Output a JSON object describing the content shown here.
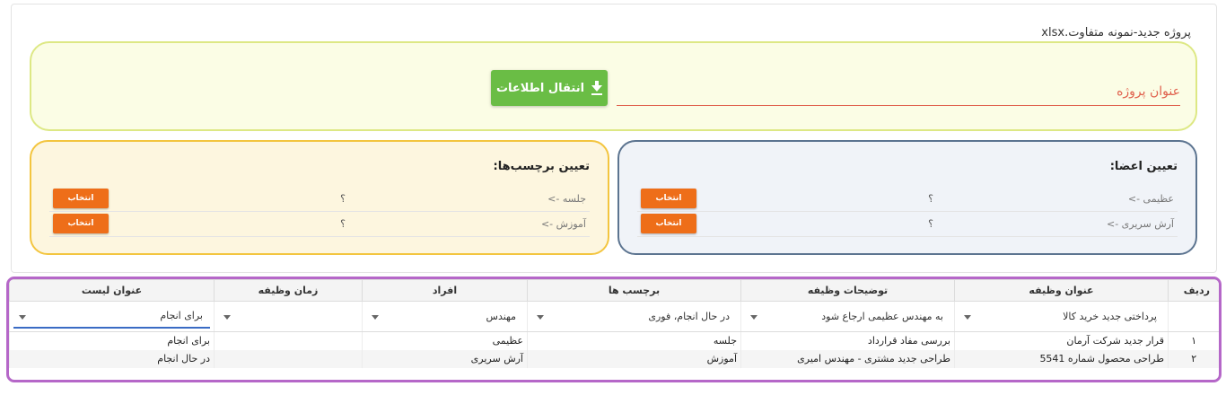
{
  "file_name": "پروژه جدید-نمونه متفاوت.xlsx",
  "project": {
    "transfer_label": "انتقال اطلاعات",
    "title_placeholder": "عنوان پروژه"
  },
  "members": {
    "title": "تعیین اعضا:",
    "rows": [
      {
        "name": "عظیمی ->",
        "value": "؟",
        "button": "انتخاب"
      },
      {
        "name": "آرش سریری ->",
        "value": "؟",
        "button": "انتخاب"
      }
    ]
  },
  "tags": {
    "title": "تعیین برچسب‌ها:",
    "rows": [
      {
        "name": "جلسه ->",
        "value": "؟",
        "button": "انتخاب"
      },
      {
        "name": "آموزش ->",
        "value": "؟",
        "button": "انتخاب"
      }
    ]
  },
  "grid": {
    "headers": {
      "row": "ردیف",
      "task_title": "عنوان وظیفه",
      "task_desc": "توضیحات وظیفه",
      "tags": "برچسب ها",
      "people": "افراد",
      "task_time": "زمان وظیفه",
      "list_title": "عنوان لیست"
    },
    "filters": {
      "task_title": "پرداختی جدید خرید کالا",
      "task_desc": "به مهندس عظیمی ارجاع شود",
      "tags": "در حال انجام، فوری",
      "people": "مهندس",
      "task_time": "",
      "list_title": "برای انجام"
    },
    "rows": [
      {
        "num": "۱",
        "task_title": "قرار جدید شرکت آرمان",
        "task_desc": "بررسی مفاد قرارداد",
        "tags": "جلسه",
        "people": "عظیمی",
        "task_time": "",
        "list_title": "برای انجام"
      },
      {
        "num": "۲",
        "task_title": "طراحی محصول شماره 5541",
        "task_desc": "طراحی جدید مشتری - مهندس امیری",
        "tags": "آموزش",
        "people": "آرش سریری",
        "task_time": "",
        "list_title": "در حال انجام"
      }
    ]
  },
  "colors": {
    "transfer_button": "#6abd45",
    "select_button": "#ee6e19",
    "project_box_border": "#dde884",
    "members_box_border": "#5c7490",
    "tags_box_border": "#f3c53f",
    "grid_border": "#b567c8",
    "title_field_accent": "#e0614d"
  }
}
